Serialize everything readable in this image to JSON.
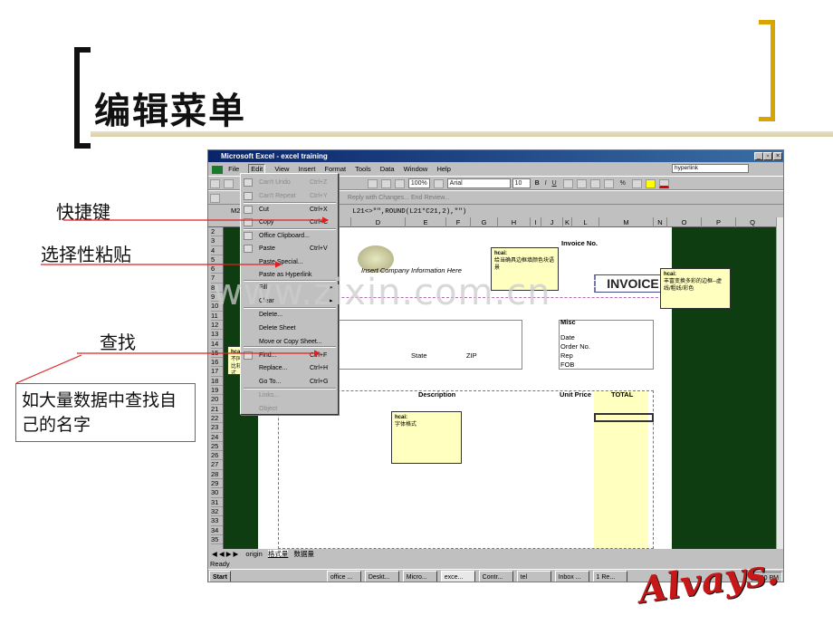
{
  "slide": {
    "title": "编辑菜单",
    "labels": {
      "shortcut": "快捷键",
      "paste_special": "选择性粘贴",
      "find": "查找"
    },
    "note": "如大量数据中查找自己的名字",
    "watermark": "www.zixin.com.cn",
    "logo_text": "Alvays."
  },
  "excel": {
    "title": "Microsoft Excel - excel training",
    "menubar": [
      "File",
      "Edit",
      "View",
      "Insert",
      "Format",
      "Tools",
      "Data",
      "Window",
      "Help"
    ],
    "hyperlink_box": "hyperlink",
    "zoom": "100%",
    "font_name": "Arial",
    "font_size": "10",
    "reply_bar": "Reply with Changes...  End Review...",
    "name_box": "M2",
    "formula": "L21<>\"\",ROUND(L21*C21,2),\"\")",
    "columns": [
      "D",
      "E",
      "F",
      "G",
      "H",
      "I",
      "J",
      "K",
      "L",
      "M",
      "N",
      "O",
      "P",
      "Q"
    ],
    "rows": [
      "2",
      "3",
      "4",
      "5",
      "6",
      "7",
      "8",
      "9",
      "10",
      "11",
      "12",
      "13",
      "14",
      "15",
      "16",
      "17",
      "18",
      "19",
      "20",
      "21",
      "22",
      "23",
      "24",
      "25",
      "26",
      "27",
      "28",
      "29",
      "30",
      "31",
      "32",
      "33",
      "34",
      "35"
    ],
    "sheet_tabs": [
      "origin",
      "格式量",
      "数据量"
    ],
    "status": "Ready",
    "cells": {
      "company_info": "Insert Company Information Here",
      "invoice_no": "Invoice No.",
      "invoice": "INVOICE",
      "misc": "Misc",
      "date": "Date",
      "order_no": "Order No.",
      "rep": "Rep",
      "fob": "FOB",
      "state": "State",
      "zip": "ZIP",
      "description": "Description",
      "unit_price": "Unit Price",
      "total": "TOTAL"
    },
    "comments": [
      {
        "author": "hcai:",
        "text": "给当确具边框填颜色块语景"
      },
      {
        "author": "hcai:",
        "text": "丰富变换多彩的边框--虚线/粗线/彩色"
      },
      {
        "author": "hcai:",
        "text": "字体格式"
      },
      {
        "author": "hcai:",
        "text": "不同样式比较 格式"
      }
    ],
    "edit_menu": [
      {
        "label": "Can't Undo",
        "shortcut": "Ctrl+Z",
        "disabled": true
      },
      {
        "label": "Can't Repeat",
        "shortcut": "Ctrl+Y",
        "disabled": true
      },
      {
        "label": "Cut",
        "shortcut": "Ctrl+X",
        "disabled": false
      },
      {
        "label": "Copy",
        "shortcut": "Ctrl+C",
        "disabled": false
      },
      {
        "label": "Office Clipboard...",
        "shortcut": "",
        "disabled": false
      },
      {
        "label": "Paste",
        "shortcut": "Ctrl+V",
        "disabled": false
      },
      {
        "label": "Paste Special...",
        "shortcut": "",
        "disabled": false
      },
      {
        "label": "Paste as Hyperlink",
        "shortcut": "",
        "disabled": false
      },
      {
        "label": "Fill",
        "shortcut": "",
        "disabled": false
      },
      {
        "label": "Clear",
        "shortcut": "",
        "disabled": false
      },
      {
        "label": "Delete...",
        "shortcut": "",
        "disabled": false
      },
      {
        "label": "Delete Sheet",
        "shortcut": "",
        "disabled": false
      },
      {
        "label": "Move or Copy Sheet...",
        "shortcut": "",
        "disabled": false
      },
      {
        "label": "Find...",
        "shortcut": "Ctrl+F",
        "disabled": false
      },
      {
        "label": "Replace...",
        "shortcut": "Ctrl+H",
        "disabled": false
      },
      {
        "label": "Go To...",
        "shortcut": "Ctrl+G",
        "disabled": false
      },
      {
        "label": "Links...",
        "shortcut": "",
        "disabled": true
      },
      {
        "label": "Object",
        "shortcut": "",
        "disabled": true
      }
    ],
    "taskbar": {
      "start": "Start",
      "tasks": [
        "office ...",
        "Deskt...",
        "Micro...",
        "exce...",
        "Contr...",
        "tel",
        "Inbox ...",
        "1 Re..."
      ],
      "clock": "1:50 PM"
    }
  },
  "colors": {
    "accent_gold": "#d9a400",
    "arrow_red": "#e02020",
    "sheet_green": "#0f3d12",
    "comment_yellow": "#ffffc0"
  }
}
